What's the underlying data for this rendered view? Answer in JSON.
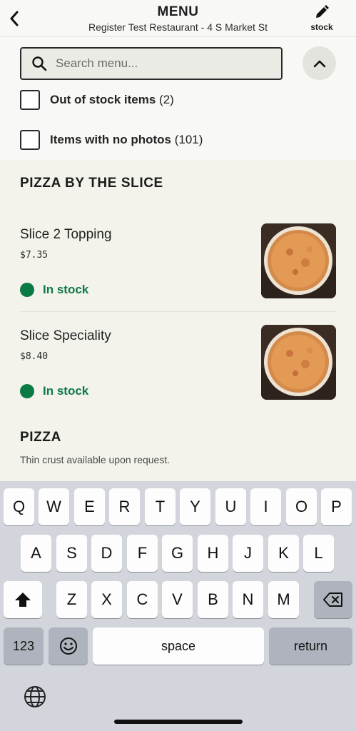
{
  "header": {
    "title": "MENU",
    "subtitle": "Register Test Restaurant - 4 S Market St",
    "stock_label": "stock"
  },
  "filters": {
    "search_placeholder": "Search menu...",
    "out_of_stock_label": "Out of stock items",
    "out_of_stock_count": "(2)",
    "no_photos_label": "Items with no photos",
    "no_photos_count": "(101)"
  },
  "sections": [
    {
      "title": "PIZZA BY THE SLICE",
      "items": [
        {
          "name": "Slice 2 Topping",
          "price": "$7.35",
          "status": "In stock"
        },
        {
          "name": "Slice Speciality",
          "price": "$8.40",
          "status": "In stock"
        }
      ]
    },
    {
      "title": "PIZZA",
      "description": "Thin crust available upon request."
    }
  ],
  "keyboard": {
    "row1": [
      "Q",
      "W",
      "E",
      "R",
      "T",
      "Y",
      "U",
      "I",
      "O",
      "P"
    ],
    "row2": [
      "A",
      "S",
      "D",
      "F",
      "G",
      "H",
      "J",
      "K",
      "L"
    ],
    "row3": [
      "Z",
      "X",
      "C",
      "V",
      "B",
      "N",
      "M"
    ],
    "numbers_label": "123",
    "space_label": "space",
    "return_label": "return"
  },
  "icons": {
    "back": "chevron-left-icon",
    "stock": "pencil-icon",
    "search": "search-icon",
    "collapse": "chevron-up-icon",
    "shift": "shift-icon",
    "delete": "backspace-icon",
    "emoji": "emoji-icon",
    "globe": "globe-icon"
  },
  "colors": {
    "in_stock": "#0b7a45",
    "background": "#f3f3ec"
  }
}
